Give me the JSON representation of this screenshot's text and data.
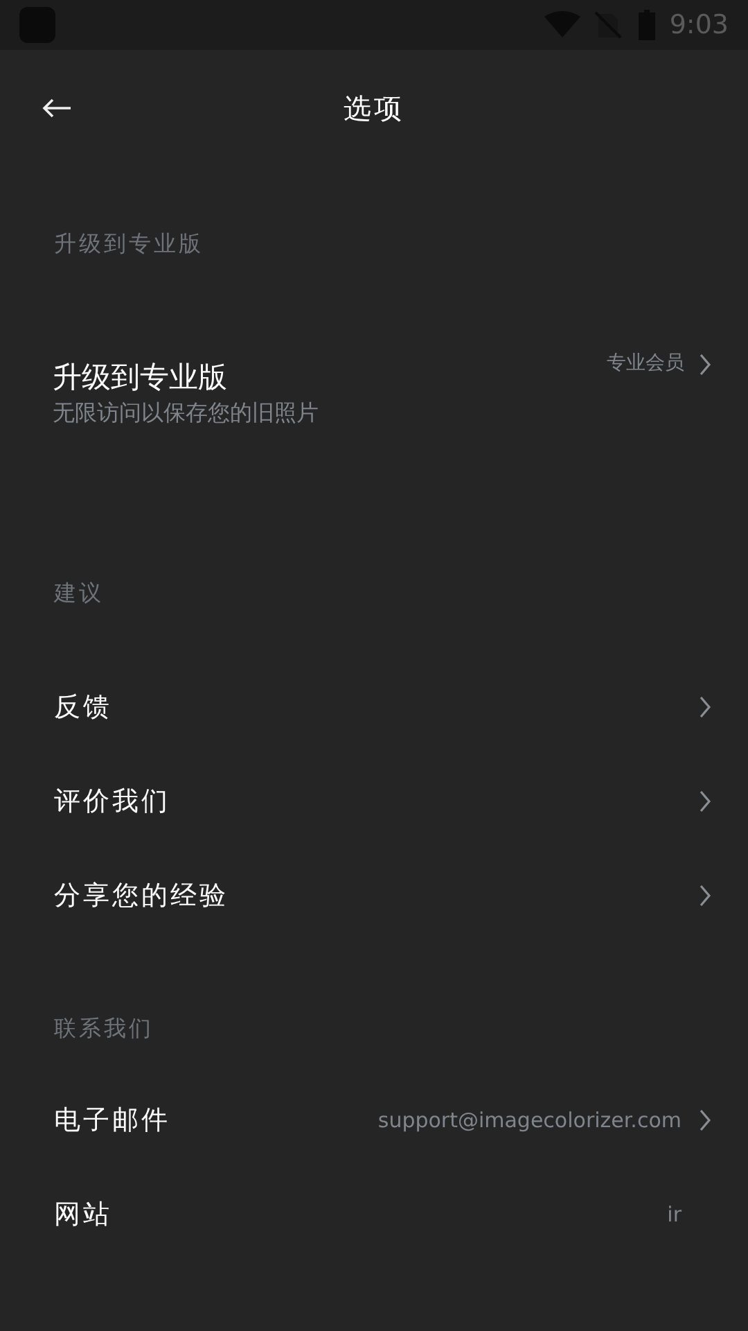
{
  "status_bar": {
    "time": "9:03"
  },
  "header": {
    "title": "选项"
  },
  "sections": [
    {
      "title": "升级到专业版",
      "items": [
        {
          "kind": "pro",
          "label": "升级到专业版",
          "subtitle": "无限访问以保存您的旧照片",
          "value": "专业会员",
          "chevron": true
        }
      ]
    },
    {
      "title": "建议",
      "items": [
        {
          "kind": "row",
          "label": "反馈",
          "chevron": true
        },
        {
          "kind": "row",
          "label": "评价我们",
          "chevron": true
        },
        {
          "kind": "row",
          "label": "分享您的经验",
          "chevron": true
        }
      ]
    },
    {
      "title": "联系我们",
      "items": [
        {
          "kind": "row",
          "label": "电子邮件",
          "value": "support@imagecolorizer.com",
          "chevron": true
        },
        {
          "kind": "row",
          "label": "网站",
          "value": "ir",
          "chevron": false
        }
      ]
    }
  ]
}
